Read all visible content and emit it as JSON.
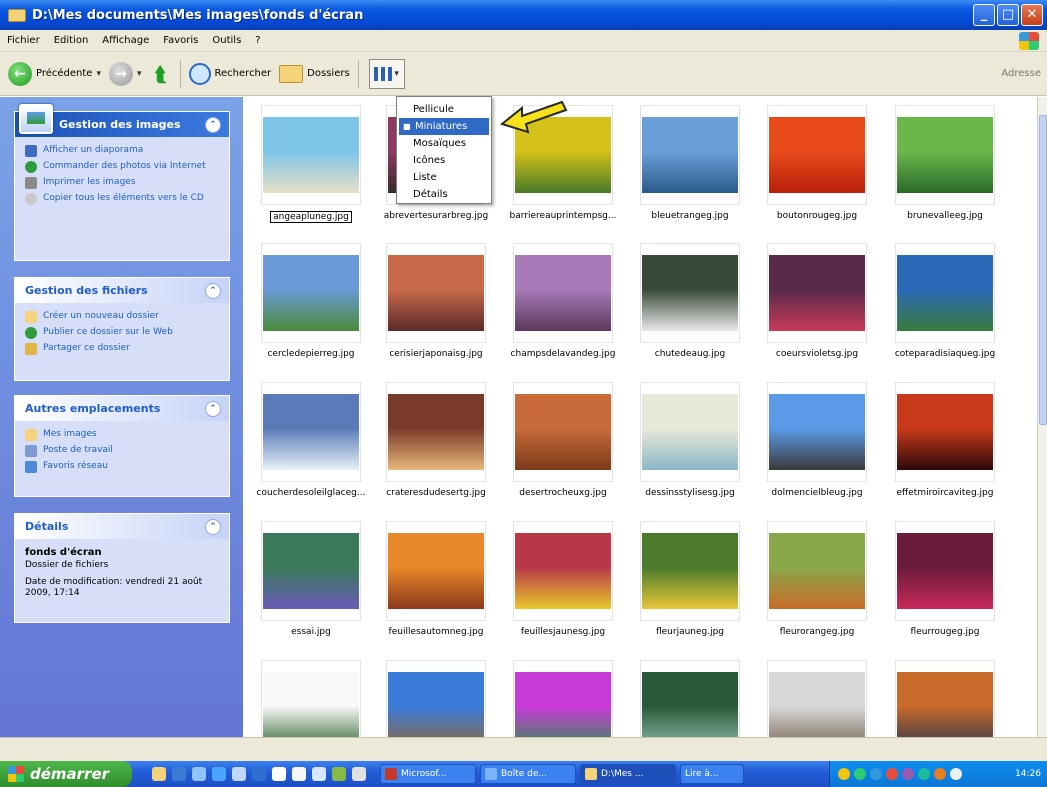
{
  "window": {
    "title": "D:\\Mes documents\\Mes images\\fonds d'écran"
  },
  "menubar": [
    "Fichier",
    "Edition",
    "Affichage",
    "Favoris",
    "Outils",
    "?"
  ],
  "toolbar": {
    "back": "Précédente",
    "search": "Rechercher",
    "folders": "Dossiers",
    "address": "Adresse"
  },
  "views_menu": {
    "items": [
      "Pellicule",
      "Miniatures",
      "Mosaïques",
      "Icônes",
      "Liste",
      "Détails"
    ],
    "selected": "Miniatures"
  },
  "sidebar": {
    "images": {
      "title": "Gestion des images",
      "tasks": [
        "Afficher un diaporama",
        "Commander des photos via Internet",
        "Imprimer les images",
        "Copier tous les éléments vers le CD"
      ]
    },
    "files": {
      "title": "Gestion des fichiers",
      "tasks": [
        "Créer un nouveau dossier",
        "Publier ce dossier sur le Web",
        "Partager ce dossier"
      ]
    },
    "places": {
      "title": "Autres emplacements",
      "tasks": [
        "Mes images",
        "Poste de travail",
        "Favoris réseau"
      ]
    },
    "details": {
      "title": "Détails",
      "name": "fonds d'écran",
      "type": "Dossier de fichiers",
      "modified": "Date de modification: vendredi 21 août 2009, 17:14"
    }
  },
  "files": [
    "angeapluneg.jpg",
    "abrevertesurarbreg.jpg",
    "barriereauprintempsg...",
    "bleuetrangeg.jpg",
    "boutonrougeg.jpg",
    "brunevalleeg.jpg",
    "cercledepierreg.jpg",
    "cerisierjaponaisg.jpg",
    "champsdelavandeg.jpg",
    "chutedeaug.jpg",
    "coeursvioletsg.jpg",
    "coteparadisiaqueg.jpg",
    "coucherdesoleilglaceg...",
    "crateresdudesertg.jpg",
    "desertrocheuxg.jpg",
    "dessinsstylisesg.jpg",
    "dolmencielbleug.jpg",
    "effetmiroircaviteg.jpg",
    "essai.jpg",
    "feuillesautomneg.jpg",
    "feuillesjaunesg.jpg",
    "fleurjauneg.jpg",
    "fleurorangeg.jpg",
    "fleurrougeg.jpg",
    "",
    "",
    "",
    "",
    "",
    ""
  ],
  "taskbar": {
    "start": "démarrer",
    "tasks": [
      "Microsof...",
      "Boîte de...",
      "D:\\Mes ...",
      "Lire à..."
    ],
    "clock": "14:26"
  }
}
